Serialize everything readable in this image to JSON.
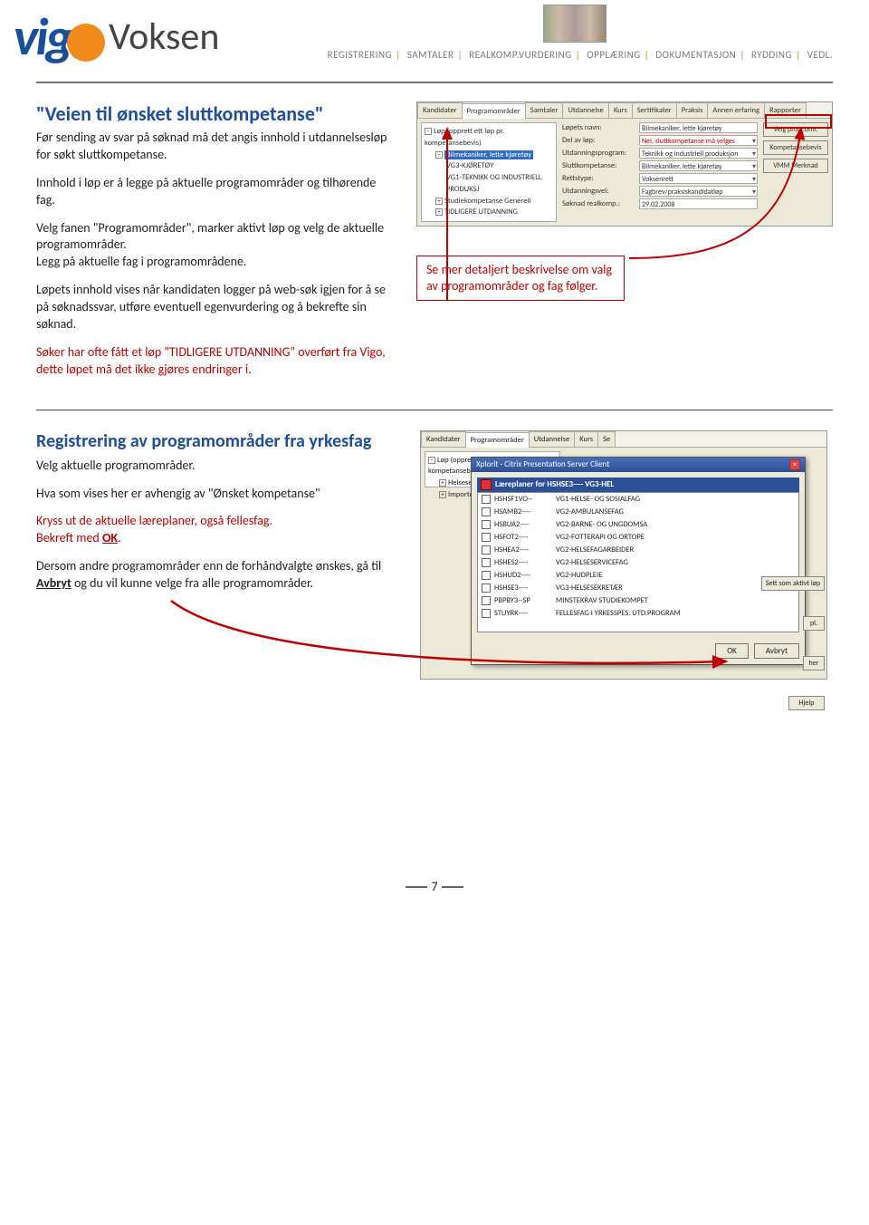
{
  "nav": [
    "REGISTRERING",
    "SAMTALER",
    "REALKOMP.VURDERING",
    "OPPLÆRING",
    "DOKUMENTASJON",
    "RYDDING",
    "VEDL."
  ],
  "logo": {
    "brand": "vigo",
    "sub": "Voksen"
  },
  "section1": {
    "title": "\"Veien til ønsket sluttkompetanse\"",
    "p1": "Før sending av svar på søknad må det angis innhold i utdannelsesløp for søkt sluttkompetanse.",
    "p2": "Innhold i løp er å legge på aktuelle programområder og tilhørende fag.",
    "p3a": "Velg fanen \"Programområder\", marker aktivt løp og velg de aktuelle programområder.",
    "p3b": "Legg på aktuelle fag i programområdene.",
    "p4": "Løpets innhold vises når kandidaten logger på web-søk igjen for å se på søknadssvar, utføre eventuell egenvurdering og å bekrefte sin søknad.",
    "p5": "Søker har ofte fått et løp \"TIDLIGERE UTDANNING\" overført fra Vigo, dette løpet må det ikke gjøres endringer i.",
    "redbox": "Se mer detaljert beskrivelse om valg av programområder og fag følger."
  },
  "shot1": {
    "tabs": [
      "Kandidater",
      "Programområder",
      "Samtaler",
      "Utdannelse",
      "Kurs",
      "Sertifikater",
      "Praksis",
      "Annen erfaring",
      "Rapporter"
    ],
    "active_tab": 1,
    "tree_root": "Løp (opprett ett løp pr. kompetansebevis)",
    "tree": [
      {
        "label": "Bilmekaniker, lette kjøretøy",
        "sel": true
      },
      {
        "label": "VG3-KJØRETØY"
      },
      {
        "label": "VG1-TEKNIKK OG INDUSTRIELL PRODUKSJ"
      },
      {
        "label": "Studiekompetanse Generell"
      },
      {
        "label": "TIDLIGERE UTDANNING"
      }
    ],
    "fields": [
      {
        "l": "Løpets navn:",
        "v": "Bilmekaniker, lette kjøretøy"
      },
      {
        "l": "Del av løp:",
        "v": "Nei, sluttkompetanse må velges",
        "red": true,
        "dd": true
      },
      {
        "l": "Utdanningsprogram:",
        "v": "Teknikk og industriell produksjon",
        "dd": true
      },
      {
        "l": "Sluttkompetanse:",
        "v": "Bilmekaniker, lette kjøretøy",
        "dd": true
      },
      {
        "l": "Rettstype:",
        "v": "Voksenrett",
        "dd": true
      },
      {
        "l": "Utdanningsvei:",
        "v": "Fagbrev/praksiskandidatløp",
        "dd": true
      },
      {
        "l": "Søknad realkomp.:",
        "v": "29.02.2008"
      }
    ],
    "buttons": [
      "Velg progr.omr.",
      "Kompetansebevis",
      "VMM Merknad"
    ]
  },
  "section2": {
    "title": "Registrering av programområder fra yrkesfag",
    "p1": "Velg aktuelle programområder.",
    "p2": "Hva som vises her er avhengig av \"Ønsket kompetanse\"",
    "p3": "Kryss ut de aktuelle læreplaner, også fellesfag.",
    "p4_pre": "Bekreft  med ",
    "p4_ok": "OK",
    "p4_post": ".",
    "p5_pre": "Dersom andre programområder enn de forhåndvalgte ønskes, gå til ",
    "p5_avbryt": "Avbryt",
    "p5_post": " og du vil kunne velge fra alle programområder."
  },
  "shot2": {
    "tabs": [
      "Kandidater",
      "Programområder",
      "Utdannelse",
      "Kurs",
      "Se"
    ],
    "tree_root": "Løp (opprett ett løp pr. kompetansebevis)",
    "tree": [
      "Helsesekretær",
      "Importerte data"
    ],
    "dlg_title": "Xplorit - Citrix Presentation Server Client",
    "lp_title": "Læreplaner for HSHSE3---- VG3-HEL",
    "rows": [
      {
        "c": "HSHSF1VO--",
        "n": "VG1-HELSE- OG SOSIALFAG"
      },
      {
        "c": "HSAMB2----",
        "n": "VG2-AMBULANSEFAG"
      },
      {
        "c": "HSBUA2----",
        "n": "VG2-BARNE- OG UNGDOMSA"
      },
      {
        "c": "HSFOT2----",
        "n": "VG2-FOTTERAPI OG ORTOPE"
      },
      {
        "c": "HSHEA2----",
        "n": "VG2-HELSEFAGARBEIDER"
      },
      {
        "c": "HSHES2----",
        "n": "VG2-HELSESERVICEFAG"
      },
      {
        "c": "HSHUD2----",
        "n": "VG2-HUDPLEIE"
      },
      {
        "c": "HSHSE3----",
        "n": "VG3-HELSESEKRETÆR"
      },
      {
        "c": "PBPBY3--SP",
        "n": "MINSTEKRAV STUDIEKOMPET"
      },
      {
        "c": "STUYRK----",
        "n": "FELLESFAG I YRKESSPES. UTD.PROGRAM"
      }
    ],
    "btn_ok": "OK",
    "btn_avbryt": "Avbryt",
    "side_buttons": [
      "Sett som aktivt løp",
      "pl.",
      "her",
      "Hjelp"
    ]
  },
  "footer": {
    "page": "7"
  }
}
